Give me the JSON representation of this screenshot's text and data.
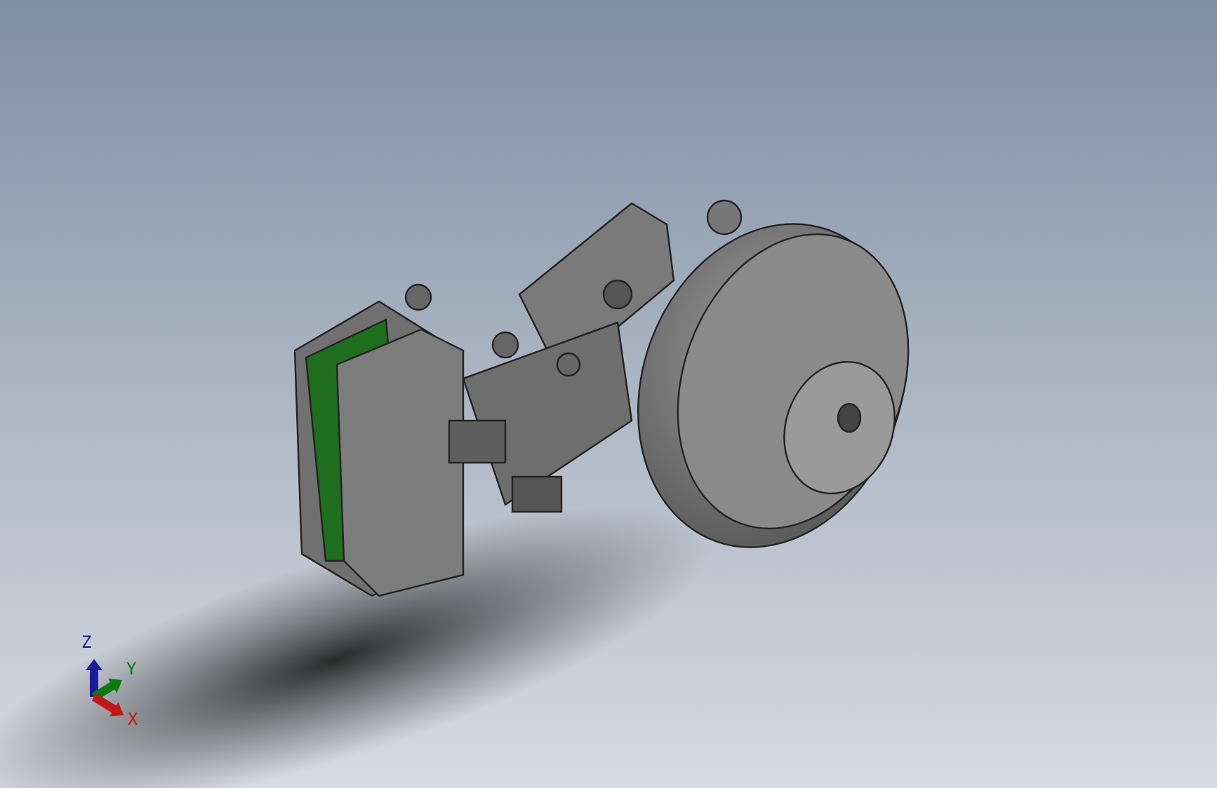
{
  "viewport": {
    "triad": {
      "axes": [
        {
          "kind": "z",
          "label": "Z",
          "color": "#1a1a9a"
        },
        {
          "kind": "y",
          "label": "Y",
          "color": "#0a7a0a"
        },
        {
          "kind": "x",
          "label": "X",
          "color": "#c01818"
        }
      ]
    }
  }
}
